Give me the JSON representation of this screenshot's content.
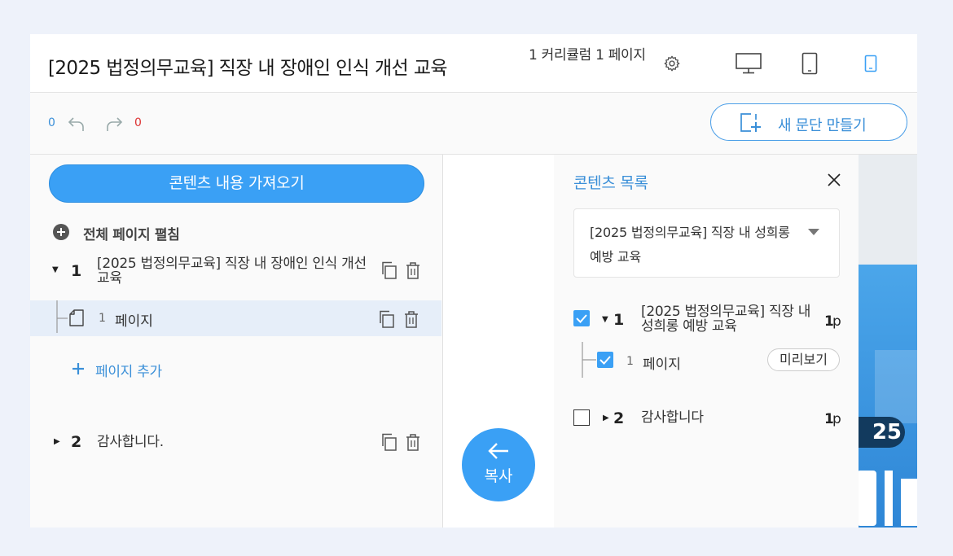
{
  "header": {
    "title": "[2025 법정의무교육] 직장 내 장애인 인식 개선 교육",
    "curriculum_info": "1 커리큘럼 1 페이지"
  },
  "toolbar": {
    "undo_count": "0",
    "redo_count": "0",
    "new_paragraph_label": "새 문단 만들기"
  },
  "left_panel": {
    "fetch_label": "콘텐츠 내용 가져오기",
    "expand_all_label": "전체 페이지 펼침",
    "curricula": [
      {
        "num": "1",
        "title": "[2025 법정의무교육] 직장 내 장애인 인식 개선 교육"
      },
      {
        "num": "2",
        "title": "감사합니다."
      }
    ],
    "page_num": "1",
    "page_label": "페이지",
    "add_page_label": "페이지 추가"
  },
  "copy_button": {
    "label": "복사"
  },
  "right_panel": {
    "title": "콘텐츠 목록",
    "select_value": "[2025 법정의무교육] 직장 내 성희롱 예방 교육",
    "items": [
      {
        "num": "1",
        "title": "[2025 법정의무교육] 직장 내 성희롱 예방 교육",
        "pages": "p",
        "count": "1"
      },
      {
        "num": "2",
        "title": "감사합니다",
        "pages": "p",
        "count": "1"
      }
    ],
    "page_num": "1",
    "page_label": "페이지",
    "preview_label": "미리보기"
  },
  "thumbnail": {
    "text": "25"
  },
  "colors": {
    "accent": "#3aa0f5",
    "accent_text": "#3a8fd8"
  }
}
